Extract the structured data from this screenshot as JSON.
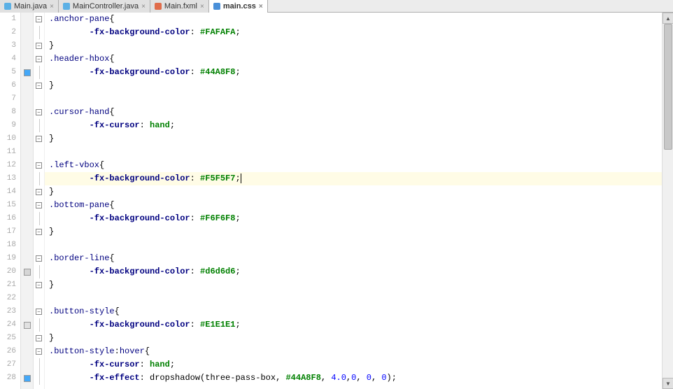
{
  "tabs": [
    {
      "label": "Main.java",
      "icon_color": "#5bb0e5",
      "active": false
    },
    {
      "label": "MainController.java",
      "icon_color": "#5bb0e5",
      "active": false
    },
    {
      "label": "Main.fxml",
      "icon_color": "#e06c4a",
      "active": false
    },
    {
      "label": "main.css",
      "icon_color": "#4a90d9",
      "active": true
    }
  ],
  "current_line": 13,
  "lines": [
    {
      "n": 1,
      "marker": null,
      "fold": "open",
      "indent": 0,
      "tokens": [
        {
          "t": ".anchor-pane",
          "c": "sel"
        },
        {
          "t": "{",
          "c": "txt"
        }
      ]
    },
    {
      "n": 2,
      "marker": null,
      "fold": "rail",
      "indent": 2,
      "tokens": [
        {
          "t": "-fx-background-color",
          "c": "prop"
        },
        {
          "t": ": ",
          "c": "txt"
        },
        {
          "t": "#FAFAFA",
          "c": "val"
        },
        {
          "t": ";",
          "c": "txt"
        }
      ]
    },
    {
      "n": 3,
      "marker": null,
      "fold": "close",
      "indent": 0,
      "tokens": [
        {
          "t": "}",
          "c": "txt"
        }
      ]
    },
    {
      "n": 4,
      "marker": null,
      "fold": "open",
      "indent": 0,
      "tokens": [
        {
          "t": ".header-hbox",
          "c": "sel"
        },
        {
          "t": "{",
          "c": "txt"
        }
      ]
    },
    {
      "n": 5,
      "marker": "#44A8F8",
      "fold": "rail",
      "indent": 2,
      "tokens": [
        {
          "t": "-fx-background-color",
          "c": "prop"
        },
        {
          "t": ": ",
          "c": "txt"
        },
        {
          "t": "#44A8F8",
          "c": "val"
        },
        {
          "t": ";",
          "c": "txt"
        }
      ]
    },
    {
      "n": 6,
      "marker": null,
      "fold": "close",
      "indent": 0,
      "tokens": [
        {
          "t": "}",
          "c": "txt"
        }
      ]
    },
    {
      "n": 7,
      "marker": null,
      "fold": null,
      "indent": 0,
      "tokens": []
    },
    {
      "n": 8,
      "marker": null,
      "fold": "open",
      "indent": 0,
      "tokens": [
        {
          "t": ".cursor-hand",
          "c": "sel"
        },
        {
          "t": "{",
          "c": "txt"
        }
      ]
    },
    {
      "n": 9,
      "marker": null,
      "fold": "rail",
      "indent": 2,
      "tokens": [
        {
          "t": "-fx-cursor",
          "c": "prop"
        },
        {
          "t": ": ",
          "c": "txt"
        },
        {
          "t": "hand",
          "c": "val"
        },
        {
          "t": ";",
          "c": "txt"
        }
      ]
    },
    {
      "n": 10,
      "marker": null,
      "fold": "close",
      "indent": 0,
      "tokens": [
        {
          "t": "}",
          "c": "txt"
        }
      ]
    },
    {
      "n": 11,
      "marker": null,
      "fold": null,
      "indent": 0,
      "tokens": []
    },
    {
      "n": 12,
      "marker": null,
      "fold": "open",
      "indent": 0,
      "tokens": [
        {
          "t": ".left-vbox",
          "c": "sel"
        },
        {
          "t": "{",
          "c": "txt"
        }
      ]
    },
    {
      "n": 13,
      "marker": null,
      "fold": "rail",
      "indent": 2,
      "tokens": [
        {
          "t": "-fx-background-color",
          "c": "prop"
        },
        {
          "t": ": ",
          "c": "txt"
        },
        {
          "t": "#F5F5F7",
          "c": "val"
        },
        {
          "t": ";",
          "c": "txt"
        }
      ],
      "caret": true
    },
    {
      "n": 14,
      "marker": null,
      "fold": "close",
      "indent": 0,
      "tokens": [
        {
          "t": "}",
          "c": "txt"
        }
      ]
    },
    {
      "n": 15,
      "marker": null,
      "fold": "open",
      "indent": 0,
      "tokens": [
        {
          "t": ".bottom-pane",
          "c": "sel"
        },
        {
          "t": "{",
          "c": "txt"
        }
      ]
    },
    {
      "n": 16,
      "marker": null,
      "fold": "rail",
      "indent": 2,
      "tokens": [
        {
          "t": "-fx-background-color",
          "c": "prop"
        },
        {
          "t": ": ",
          "c": "txt"
        },
        {
          "t": "#F6F6F8",
          "c": "val"
        },
        {
          "t": ";",
          "c": "txt"
        }
      ]
    },
    {
      "n": 17,
      "marker": null,
      "fold": "close",
      "indent": 0,
      "tokens": [
        {
          "t": "}",
          "c": "txt"
        }
      ]
    },
    {
      "n": 18,
      "marker": null,
      "fold": null,
      "indent": 0,
      "tokens": []
    },
    {
      "n": 19,
      "marker": null,
      "fold": "open",
      "indent": 0,
      "tokens": [
        {
          "t": ".border-line",
          "c": "sel"
        },
        {
          "t": "{",
          "c": "txt"
        }
      ]
    },
    {
      "n": 20,
      "marker": "#d6d6d6",
      "fold": "rail",
      "indent": 2,
      "tokens": [
        {
          "t": "-fx-background-color",
          "c": "prop"
        },
        {
          "t": ": ",
          "c": "txt"
        },
        {
          "t": "#d6d6d6",
          "c": "val"
        },
        {
          "t": ";",
          "c": "txt"
        }
      ]
    },
    {
      "n": 21,
      "marker": null,
      "fold": "close",
      "indent": 0,
      "tokens": [
        {
          "t": "}",
          "c": "txt"
        }
      ]
    },
    {
      "n": 22,
      "marker": null,
      "fold": null,
      "indent": 0,
      "tokens": []
    },
    {
      "n": 23,
      "marker": null,
      "fold": "open",
      "indent": 0,
      "tokens": [
        {
          "t": ".button-style",
          "c": "sel"
        },
        {
          "t": "{",
          "c": "txt"
        }
      ]
    },
    {
      "n": 24,
      "marker": "#E1E1E1",
      "fold": "rail",
      "indent": 2,
      "tokens": [
        {
          "t": "-fx-background-color",
          "c": "prop"
        },
        {
          "t": ": ",
          "c": "txt"
        },
        {
          "t": "#E1E1E1",
          "c": "val"
        },
        {
          "t": ";",
          "c": "txt"
        }
      ]
    },
    {
      "n": 25,
      "marker": null,
      "fold": "close",
      "indent": 0,
      "tokens": [
        {
          "t": "}",
          "c": "txt"
        }
      ]
    },
    {
      "n": 26,
      "marker": null,
      "fold": "open",
      "indent": 0,
      "tokens": [
        {
          "t": ".button-style",
          "c": "sel"
        },
        {
          "t": ":",
          "c": "txt"
        },
        {
          "t": "hover",
          "c": "sel"
        },
        {
          "t": "{",
          "c": "txt"
        }
      ]
    },
    {
      "n": 27,
      "marker": null,
      "fold": "rail",
      "indent": 2,
      "tokens": [
        {
          "t": "-fx-cursor",
          "c": "prop"
        },
        {
          "t": ": ",
          "c": "txt"
        },
        {
          "t": "hand",
          "c": "val"
        },
        {
          "t": ";",
          "c": "txt"
        }
      ]
    },
    {
      "n": 28,
      "marker": "#44A8F8",
      "fold": "rail",
      "indent": 2,
      "tokens": [
        {
          "t": "-fx-effect",
          "c": "prop"
        },
        {
          "t": ": ",
          "c": "txt"
        },
        {
          "t": "dropshadow",
          "c": "func"
        },
        {
          "t": "(",
          "c": "txt"
        },
        {
          "t": "three-pass-box",
          "c": "txt"
        },
        {
          "t": ", ",
          "c": "txt"
        },
        {
          "t": "#44A8F8",
          "c": "val"
        },
        {
          "t": ", ",
          "c": "txt"
        },
        {
          "t": "4.0",
          "c": "num"
        },
        {
          "t": ",",
          "c": "txt"
        },
        {
          "t": "0",
          "c": "num"
        },
        {
          "t": ", ",
          "c": "txt"
        },
        {
          "t": "0",
          "c": "num"
        },
        {
          "t": ", ",
          "c": "txt"
        },
        {
          "t": "0",
          "c": "num"
        },
        {
          "t": ");",
          "c": "txt"
        }
      ]
    }
  ]
}
